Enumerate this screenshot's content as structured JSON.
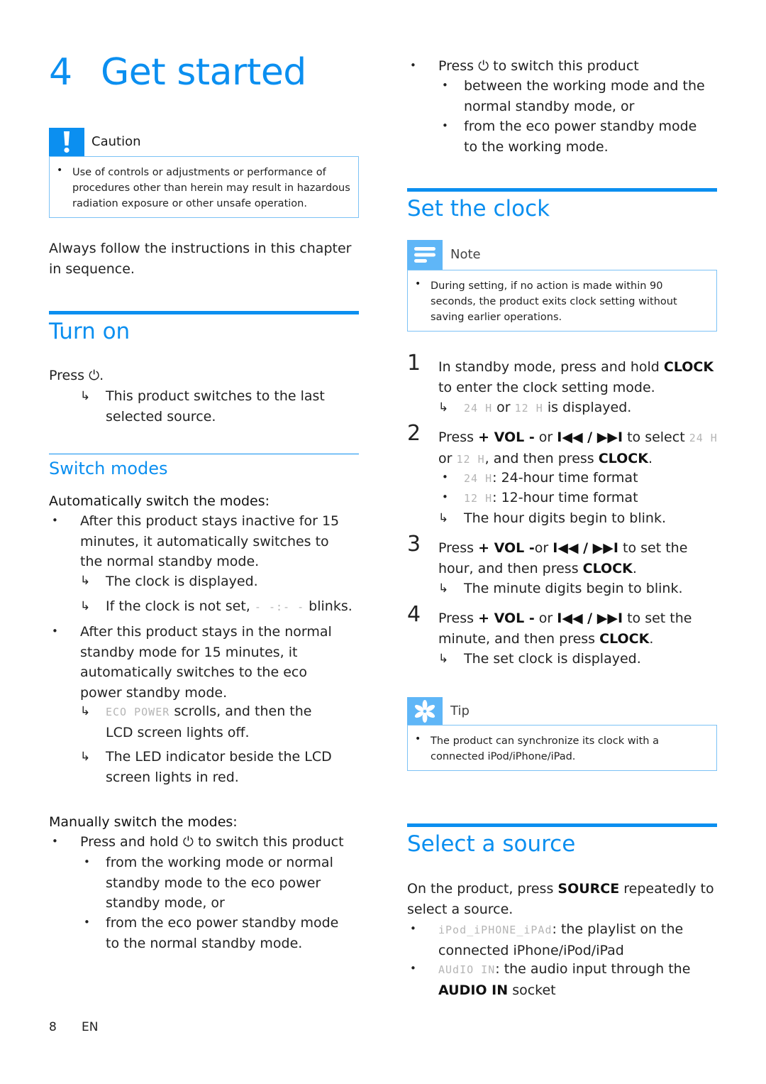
{
  "chapter": {
    "number": "4",
    "title": "Get started"
  },
  "caution": {
    "title": "Caution",
    "icon": "exclamation-icon",
    "items": [
      "Use of controls or adjustments or performance of procedures other than herein may result in hazardous radiation exposure or other unsafe operation."
    ]
  },
  "intro": "Always follow the instructions in this chapter in sequence.",
  "turn_on": {
    "heading": "Turn on",
    "press": "Press",
    "power_icon": "power-icon",
    "result": "This product switches to the last selected source."
  },
  "switch_modes": {
    "heading": "Switch modes",
    "auto_label": "Automatically switch the modes:",
    "auto_items": [
      {
        "text": "After this product stays inactive for 15 minutes, it automatically switches to the normal standby mode.",
        "results": [
          "The clock is displayed.",
          "If the clock is not set,",
          "blinks."
        ],
        "lcd_blink": "- -:- -"
      },
      {
        "text": "After this product stays in the normal standby mode for 15 minutes, it automatically switches to the eco power standby mode.",
        "lcd_scroll": "ECO POWER",
        "result1_suffix": "scrolls, and then the LCD screen lights off.",
        "result2": "The LED indicator beside the LCD screen lights in red."
      }
    ],
    "manual_label": "Manually switch the modes:",
    "manual_items": [
      {
        "text_pre": "Press and hold",
        "text_post": "to switch this product",
        "sub": [
          "from the working mode or normal standby mode to the eco power standby mode, or",
          "from the eco power standby mode to the normal standby mode."
        ]
      },
      {
        "text_pre": "Press",
        "text_post": "to switch this product",
        "sub": [
          "between the working mode and the normal standby mode, or",
          "from the eco power standby mode to the working mode."
        ]
      }
    ]
  },
  "set_clock": {
    "heading": "Set the clock",
    "note": {
      "title": "Note",
      "icon": "note-lines-icon",
      "items": [
        "During setting, if no action is made within 90 seconds, the product exits clock setting without saving earlier operations."
      ]
    },
    "lcd_24h": "24 H",
    "lcd_12h": "12 H",
    "steps": [
      {
        "num": "1",
        "pre": "In standby mode, press and hold",
        "bold": "CLOCK",
        "post": "to enter the clock setting mode.",
        "result_or": "or",
        "result_post": "is displayed."
      },
      {
        "num": "2",
        "pre": "Press",
        "bold1": "+ VOL -",
        "mid": "or",
        "bold2": "I◀◀ / ▶▶I",
        "post1": "to select",
        "or": "or",
        "post2": ", and then press",
        "bold3": "CLOCK",
        "dot": ".",
        "options": [
          ": 24-hour time format",
          ": 12-hour time format"
        ],
        "result": "The hour digits begin to blink."
      },
      {
        "num": "3",
        "pre": "Press",
        "bold1": "+ VOL -",
        "mid": "or",
        "bold2": "I◀◀ / ▶▶I",
        "post1": "to set the hour, and then press",
        "bold3": "CLOCK",
        "dot": ".",
        "result": "The minute digits begin to blink."
      },
      {
        "num": "4",
        "pre": "Press",
        "bold1": "+ VOL -",
        "mid": "or",
        "bold2": "I◀◀ / ▶▶I",
        "post1": "to set the minute, and then press",
        "bold3": "CLOCK",
        "dot": ".",
        "result": "The set clock is displayed."
      }
    ],
    "tip": {
      "title": "Tip",
      "icon": "asterisk-icon",
      "items": [
        "The product can synchronize its clock with a connected iPod/iPhone/iPad."
      ]
    }
  },
  "select_source": {
    "heading": "Select a source",
    "intro_pre": "On the product, press",
    "intro_bold": "SOURCE",
    "intro_post": "repeatedly to select a source.",
    "items": [
      {
        "lcd": "iPod_iPHONE_iPAd",
        "text": ": the playlist on the connected iPhone/iPod/iPad"
      },
      {
        "lcd": "AUdIO IN",
        "text": ": the audio input through the",
        "bold": "AUDIO IN",
        "post": "socket"
      }
    ]
  },
  "footer": {
    "page": "8",
    "lang": "EN"
  }
}
